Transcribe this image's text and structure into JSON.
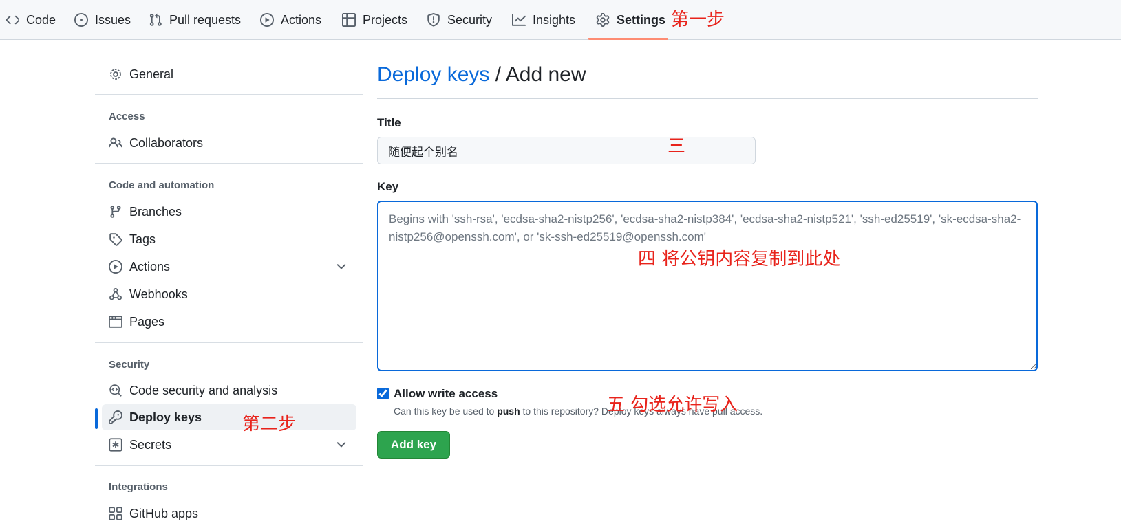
{
  "nav": {
    "tabs": [
      {
        "label": "Code",
        "icon": "code-icon"
      },
      {
        "label": "Issues",
        "icon": "issue-opened-icon"
      },
      {
        "label": "Pull requests",
        "icon": "git-pull-request-icon"
      },
      {
        "label": "Actions",
        "icon": "play-icon"
      },
      {
        "label": "Projects",
        "icon": "table-icon"
      },
      {
        "label": "Security",
        "icon": "shield-icon"
      },
      {
        "label": "Insights",
        "icon": "graph-icon"
      },
      {
        "label": "Settings",
        "icon": "gear-icon",
        "selected": true
      }
    ]
  },
  "sidebar": {
    "general": "General",
    "access_heading": "Access",
    "collaborators": "Collaborators",
    "code_automation_heading": "Code and automation",
    "branches": "Branches",
    "tags": "Tags",
    "actions": "Actions",
    "webhooks": "Webhooks",
    "pages": "Pages",
    "security_heading": "Security",
    "code_security": "Code security and analysis",
    "deploy_keys": "Deploy keys",
    "secrets": "Secrets",
    "integrations_heading": "Integrations",
    "github_apps": "GitHub apps"
  },
  "main": {
    "breadcrumb_link": "Deploy keys",
    "breadcrumb_sep": " / ",
    "breadcrumb_current": "Add new",
    "title_label": "Title",
    "title_value": "随便起个别名",
    "key_label": "Key",
    "key_placeholder": "Begins with 'ssh-rsa', 'ecdsa-sha2-nistp256', 'ecdsa-sha2-nistp384', 'ecdsa-sha2-nistp521', 'ssh-ed25519', 'sk-ecdsa-sha2-nistp256@openssh.com', or 'sk-ssh-ed25519@openssh.com'",
    "allow_write_label": "Allow write access",
    "allow_write_checked": true,
    "note_prefix": "Can this key be used to ",
    "note_bold": "push",
    "note_suffix": " to this repository? Deploy keys always have pull access.",
    "add_button": "Add key"
  },
  "annotations": {
    "step1": "第一步",
    "step2": "第二步",
    "step3": "三",
    "step4": "四 将公钥内容复制到此处",
    "step5": "五 勾选允许写入"
  },
  "colors": {
    "accent": "#0969da",
    "button_green": "#2da44e",
    "tab_underline": "#fd8c73",
    "annotation_red": "#e8231b"
  }
}
